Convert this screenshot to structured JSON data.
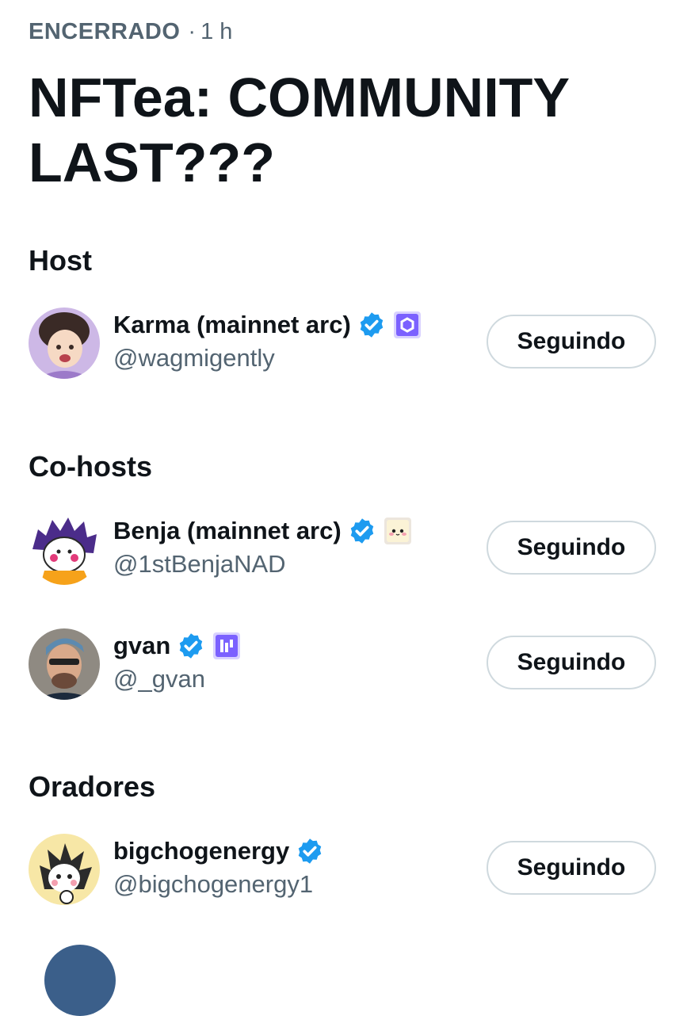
{
  "space": {
    "status": "ENCERRADO",
    "separator": "·",
    "age": "1 h",
    "title": "NFTea: COMMUNITY LAST???"
  },
  "sections": {
    "host": "Host",
    "cohosts": "Co-hosts",
    "speakers": "Oradores"
  },
  "people": [
    {
      "name": "Karma (mainnet arc)",
      "handle": "@wagmigently",
      "verified": true,
      "badge": "purple-hexagon-icon",
      "button": "Seguindo"
    },
    {
      "name": "Benja (mainnet arc)",
      "handle": "@1stBenjaNAD",
      "verified": true,
      "badge": "cute-face-icon",
      "button": "Seguindo"
    },
    {
      "name": "gvan",
      "handle": "@_gvan",
      "verified": true,
      "badge": "purple-bars-icon",
      "button": "Seguindo"
    },
    {
      "name": "bigchogenergy",
      "handle": "@bigchogenergy1",
      "verified": true,
      "button": "Seguindo"
    }
  ],
  "colors": {
    "verified_blue": "#1d9bf0",
    "text_primary": "#0f1419",
    "text_secondary": "#536471",
    "button_border": "#cfd9de",
    "badge_purple": "#7b61ff"
  }
}
